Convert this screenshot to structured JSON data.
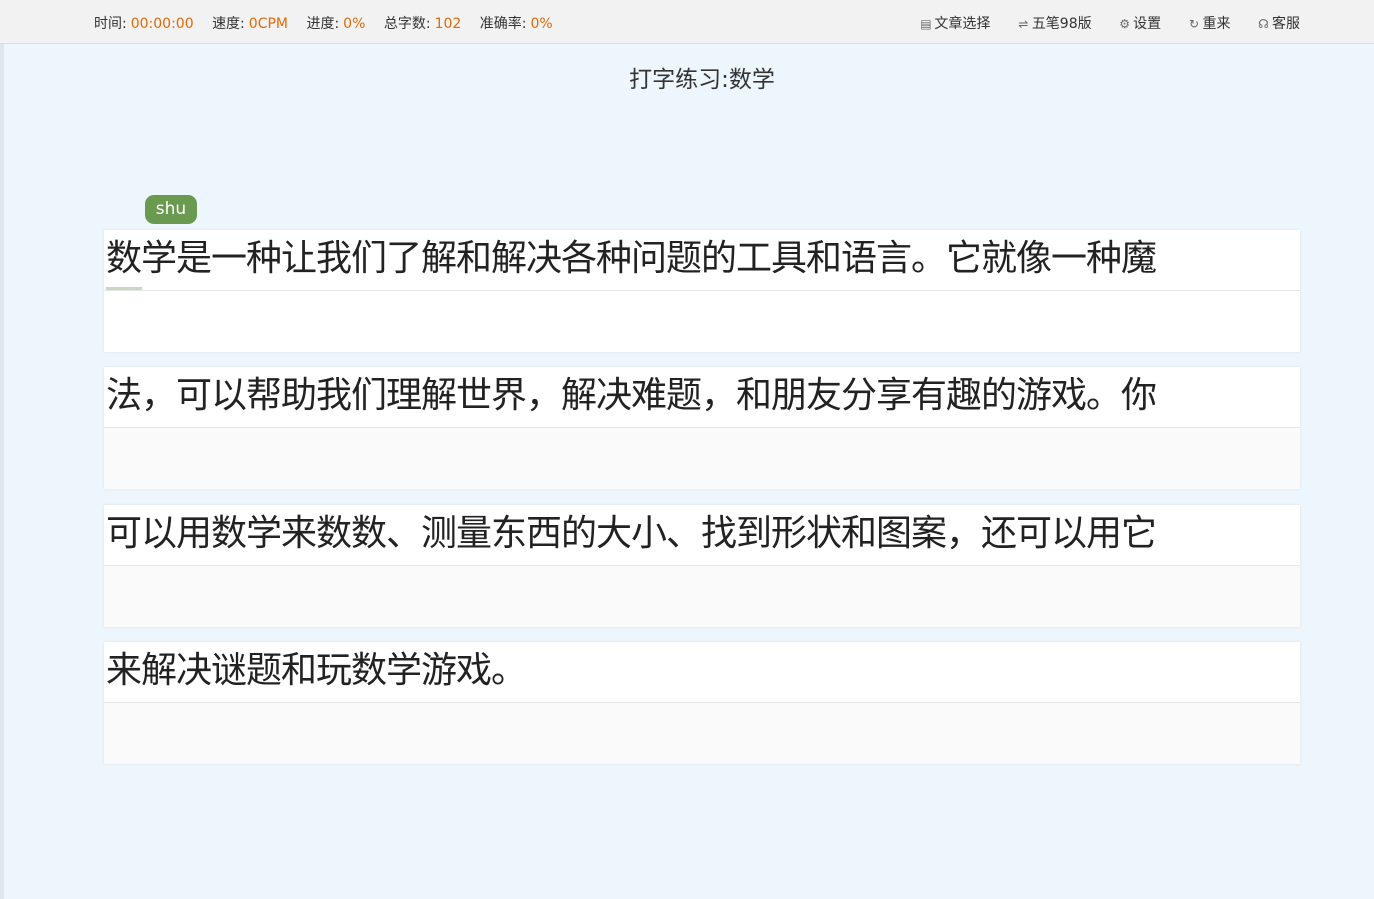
{
  "stats": [
    {
      "label": "时间:",
      "value": "00:00:00"
    },
    {
      "label": "速度:",
      "value": "0CPM"
    },
    {
      "label": "进度:",
      "value": "0%"
    },
    {
      "label": "总字数:",
      "value": "102"
    },
    {
      "label": "准确率:",
      "value": "0%"
    }
  ],
  "actions": [
    {
      "icon": "▤",
      "label": "文章选择",
      "icon_name": "document-list-icon"
    },
    {
      "icon": "⇌",
      "label": "五笔98版",
      "icon_name": "swap-icon"
    },
    {
      "icon": "⚙",
      "label": "设置",
      "icon_name": "gear-icon"
    },
    {
      "icon": "↻",
      "label": "重来",
      "icon_name": "refresh-icon"
    },
    {
      "icon": "☊",
      "label": "客服",
      "icon_name": "headset-icon"
    }
  ],
  "page_title": "打字练习:数学",
  "pinyin_hint": "shu",
  "lines": [
    {
      "text": "数学是一种让我们了解和解决各种问题的工具和语言。它就像一种魔",
      "typed": ""
    },
    {
      "text": "法，可以帮助我们理解世界，解决难题，和朋友分享有趣的游戏。你",
      "typed": ""
    },
    {
      "text": "可以用数学来数数、测量东西的大小、找到形状和图案，还可以用它",
      "typed": ""
    },
    {
      "text": "来解决谜题和玩数学游戏。",
      "typed": ""
    }
  ],
  "colors": {
    "accent_value": "#e06a0a",
    "pinyin_badge": "#6a9a4f",
    "background": "#eef6fd"
  }
}
